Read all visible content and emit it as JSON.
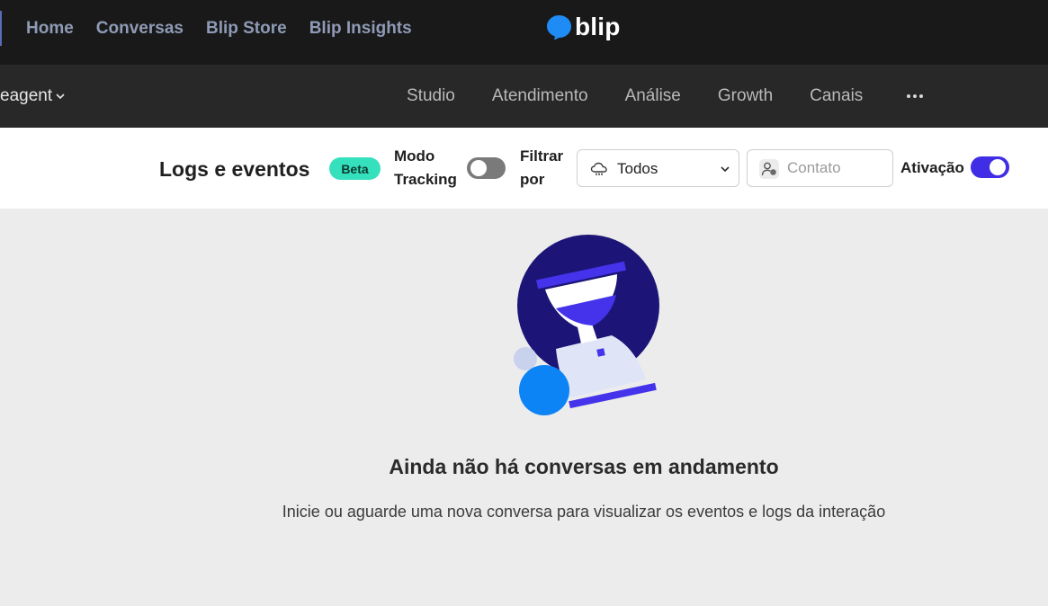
{
  "topnav": {
    "links": [
      "Home",
      "Conversas",
      "Blip Store",
      "Blip Insights"
    ],
    "logo_text": "blip"
  },
  "subnav": {
    "bot_name": "eagent",
    "menu": [
      "Studio",
      "Atendimento",
      "Análise",
      "Growth",
      "Canais"
    ]
  },
  "toolbar": {
    "title": "Logs e eventos",
    "badge": "Beta",
    "tracking_label_1": "Modo",
    "tracking_label_2": "Tracking",
    "tracking_on": false,
    "filter_label_1": "Filtrar",
    "filter_label_2": "por",
    "filter_value": "Todos",
    "contact_placeholder": "Contato",
    "activation_label": "Ativação",
    "activation_on": true
  },
  "empty": {
    "title": "Ainda não há conversas em andamento",
    "subtitle": "Inicie ou aguarde uma nova conversa para visualizar os eventos e logs da interação"
  },
  "colors": {
    "accent": "#3f2ee6",
    "badge": "#35e0bc",
    "topbar": "#191919",
    "subbar": "#282828"
  }
}
